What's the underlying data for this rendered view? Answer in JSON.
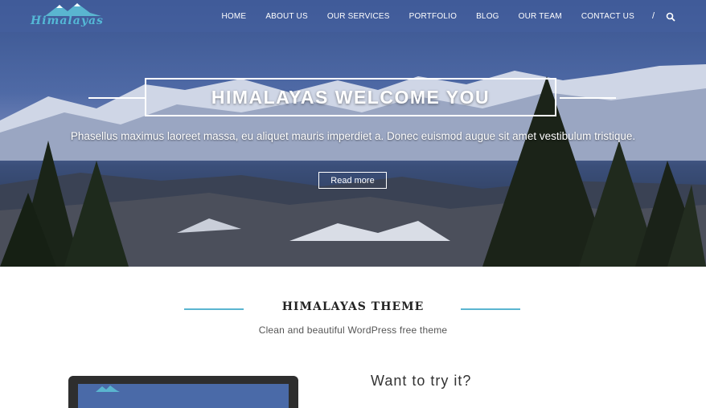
{
  "logo": {
    "text": "Himalayas"
  },
  "nav": {
    "items": [
      {
        "label": "HOME"
      },
      {
        "label": "ABOUT US"
      },
      {
        "label": "OUR SERVICES"
      },
      {
        "label": "PORTFOLIO"
      },
      {
        "label": "BLOG"
      },
      {
        "label": "OUR TEAM"
      },
      {
        "label": "CONTACT US"
      }
    ],
    "separator": "/"
  },
  "hero": {
    "title": "HIMALAYAS WELCOME YOU",
    "description": "Phasellus maximus laoreet massa, eu aliquet mauris imperdiet a. Donec euismod augue sit amet vestibulum tristique.",
    "button_label": "Read more"
  },
  "theme_section": {
    "title": "HIMALAYAS THEME",
    "subtitle": "Clean and beautiful WordPress free theme"
  },
  "try_section": {
    "title": "Want to try it?"
  },
  "colors": {
    "accent": "#5ab5d0",
    "nav_overlay": "#4660a0",
    "text_dark": "#222222"
  }
}
